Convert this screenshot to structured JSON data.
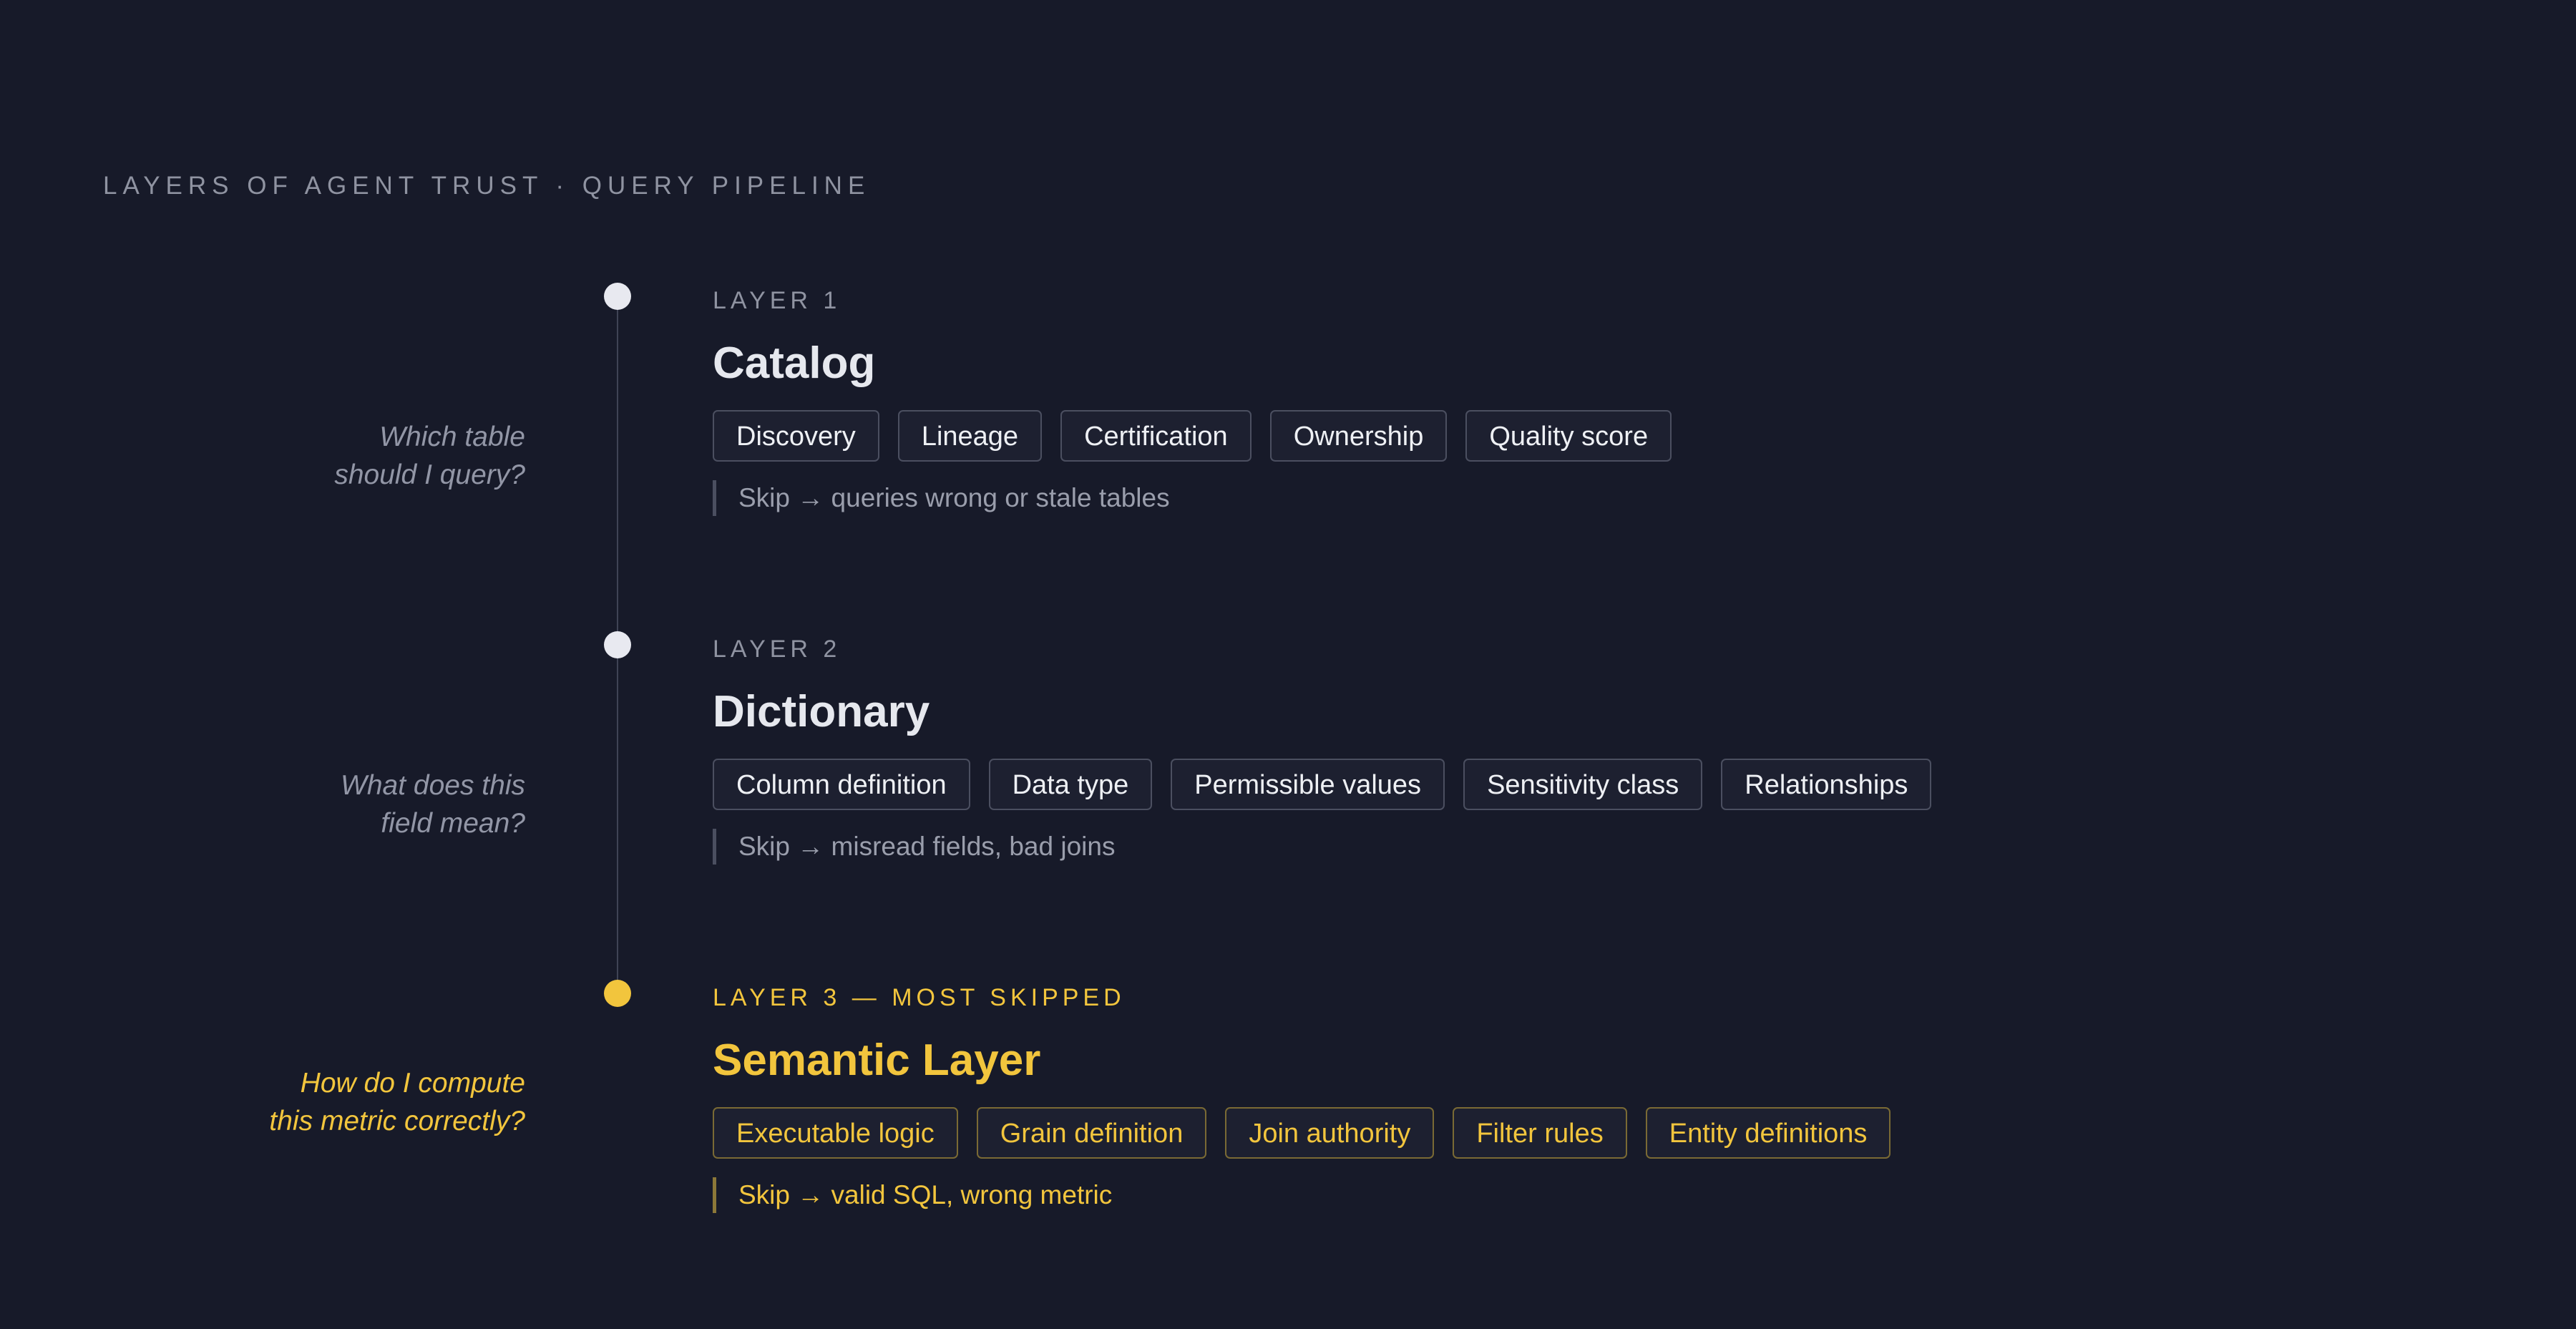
{
  "header": {
    "title": "LAYERS OF AGENT TRUST · QUERY PIPELINE"
  },
  "colors": {
    "background": "#171a29",
    "text": "#e6e8ee",
    "muted": "#8f93a1",
    "accent": "#f2c53d"
  },
  "layers": [
    {
      "label": "LAYER 1",
      "title": "Catalog",
      "question": [
        "Which table",
        "should I query?"
      ],
      "chips": [
        "Discovery",
        "Lineage",
        "Certification",
        "Ownership",
        "Quality score"
      ],
      "skip": "Skip → queries wrong or stale tables",
      "highlighted": false
    },
    {
      "label": "LAYER 2",
      "title": "Dictionary",
      "question": [
        "What does this",
        "field mean?"
      ],
      "chips": [
        "Column definition",
        "Data type",
        "Permissible values",
        "Sensitivity class",
        "Relationships"
      ],
      "skip": "Skip → misread fields, bad joins",
      "highlighted": false
    },
    {
      "label": "LAYER 3 — MOST SKIPPED",
      "title": "Semantic Layer",
      "question": [
        "How do I compute",
        "this metric correctly?"
      ],
      "chips": [
        "Executable logic",
        "Grain definition",
        "Join authority",
        "Filter rules",
        "Entity definitions"
      ],
      "skip": "Skip → valid SQL, wrong metric",
      "highlighted": true
    }
  ]
}
